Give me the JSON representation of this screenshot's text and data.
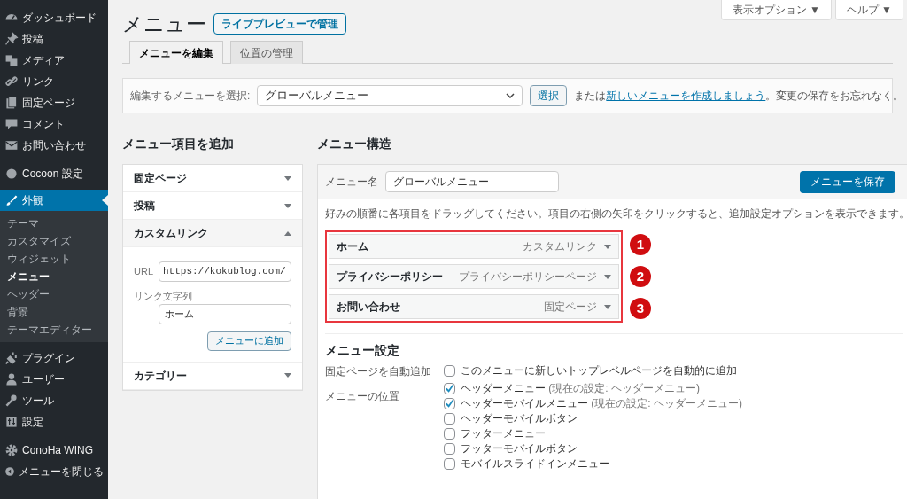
{
  "sidebar": {
    "items": [
      {
        "label": "ダッシュボード",
        "selected": false
      },
      {
        "label": "投稿",
        "selected": false
      },
      {
        "label": "メディア",
        "selected": false
      },
      {
        "label": "リンク",
        "selected": false
      },
      {
        "label": "固定ページ",
        "selected": false
      },
      {
        "label": "コメント",
        "selected": false
      },
      {
        "label": "お問い合わせ",
        "selected": false
      },
      {
        "label": "Cocoon 設定",
        "selected": false
      },
      {
        "label": "外観",
        "selected": true,
        "children": [
          {
            "label": "テーマ",
            "selected": false
          },
          {
            "label": "カスタマイズ",
            "selected": false
          },
          {
            "label": "ウィジェット",
            "selected": false
          },
          {
            "label": "メニュー",
            "selected": true
          },
          {
            "label": "ヘッダー",
            "selected": false
          },
          {
            "label": "背景",
            "selected": false
          },
          {
            "label": "テーマエディター",
            "selected": false
          }
        ]
      },
      {
        "label": "プラグイン",
        "selected": false
      },
      {
        "label": "ユーザー",
        "selected": false
      },
      {
        "label": "ツール",
        "selected": false
      },
      {
        "label": "設定",
        "selected": false
      },
      {
        "label": "ConoHa WING",
        "selected": false
      },
      {
        "label": "メニューを閉じる",
        "selected": false
      }
    ]
  },
  "screen_options": [
    "表示オプション ▼",
    "ヘルプ ▼"
  ],
  "title": "メニュー",
  "live_preview_button": "ライブプレビューで管理",
  "tabs": [
    {
      "label": "メニューを編集",
      "selected": true
    },
    {
      "label": "位置の管理",
      "selected": false
    }
  ],
  "select_bar": {
    "label": "編集するメニューを選択:",
    "value": "グローバルメニュー",
    "button": "選択",
    "note_before": "または",
    "link": "新しいメニューを作成しましょう",
    "note_after": "。変更の保存をお忘れなく。"
  },
  "add_items": {
    "heading": "メニュー項目を追加",
    "sections": [
      {
        "label": "固定ページ",
        "expanded": false
      },
      {
        "label": "投稿",
        "expanded": false
      },
      {
        "label": "カスタムリンク",
        "expanded": true,
        "url_label": "URL",
        "url_value": "https://kokublog.com/",
        "text_label": "リンク文字列",
        "text_value": "ホーム",
        "button": "メニューに追加"
      },
      {
        "label": "カテゴリー",
        "expanded": false
      }
    ]
  },
  "structure": {
    "heading": "メニュー構造",
    "name_label": "メニュー名",
    "name_value": "グローバルメニュー",
    "save_button": "メニューを保存",
    "instructions": "好みの順番に各項目をドラッグしてください。項目の右側の矢印をクリックすると、追加設定オプションを表示できます。",
    "items": [
      {
        "title": "ホーム",
        "type": "カスタムリンク",
        "badge": "1"
      },
      {
        "title": "プライバシーポリシー",
        "type": "プライバシーポリシーページ",
        "badge": "2"
      },
      {
        "title": "お問い合わせ",
        "type": "固定ページ",
        "badge": "3"
      }
    ]
  },
  "settings": {
    "heading": "メニュー設定",
    "auto_add_label": "固定ページを自動追加",
    "auto_add": {
      "label": "このメニューに新しいトップレベルページを自動的に追加",
      "checked": false
    },
    "locations_label": "メニューの位置",
    "locations": [
      {
        "label": "ヘッダーメニュー",
        "note": "(現在の設定: ヘッダーメニュー)",
        "checked": true
      },
      {
        "label": "ヘッダーモバイルメニュー",
        "note": "(現在の設定: ヘッダーメニュー)",
        "checked": true
      },
      {
        "label": "ヘッダーモバイルボタン",
        "checked": false
      },
      {
        "label": "フッターメニュー",
        "checked": false
      },
      {
        "label": "フッターモバイルボタン",
        "checked": false
      },
      {
        "label": "モバイルスライドインメニュー",
        "checked": false
      }
    ]
  }
}
